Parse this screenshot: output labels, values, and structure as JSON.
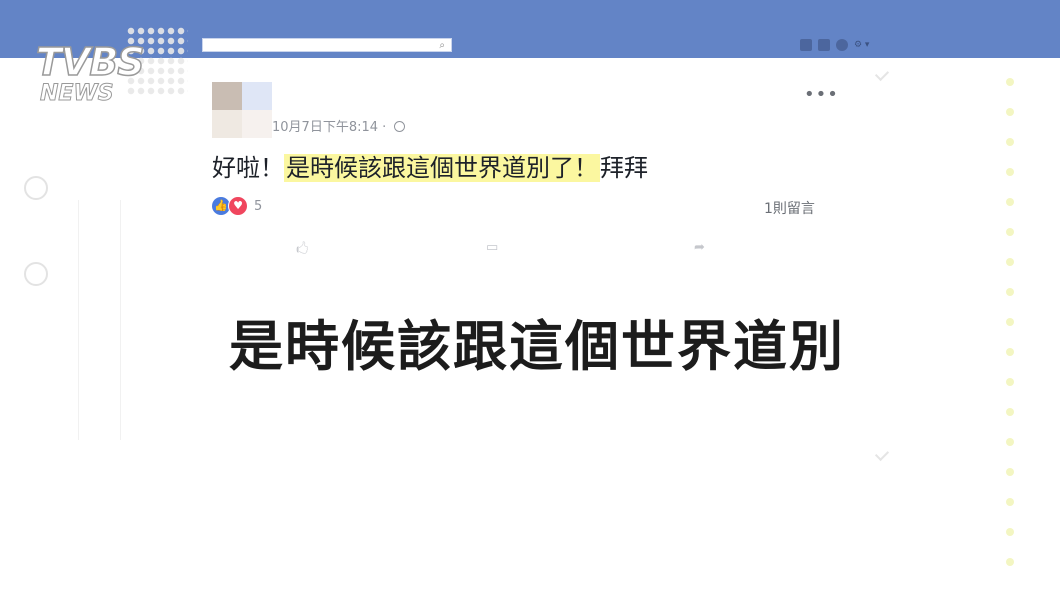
{
  "logo": {
    "main": "TVBS",
    "sub": "NEWS"
  },
  "search": {
    "placeholder": ""
  },
  "nav": {
    "help_label": "⚙ ▾"
  },
  "post": {
    "timestamp": "10月7日下午8:14 · ",
    "text_prefix": "好啦！",
    "text_highlight": "是時候該跟這個世界道別了！",
    "text_suffix": "拜拜",
    "reaction_count": "5",
    "comment_count": "1則留言",
    "more": "•••"
  },
  "caption": "是時候該跟這個世界道別",
  "colors": {
    "topbar": "#6384c6",
    "highlight": "#fbf7a0",
    "like": "#4a7bdf",
    "love": "#f0465e"
  }
}
